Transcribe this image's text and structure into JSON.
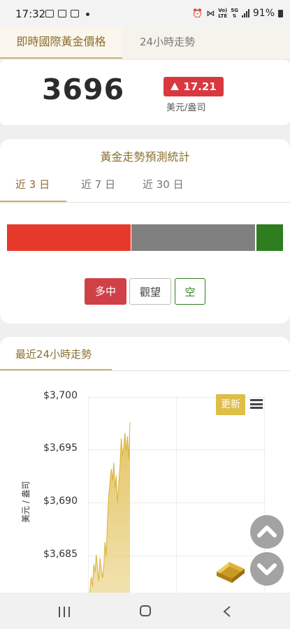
{
  "status_bar": {
    "time": "17:32",
    "network_lte": "LTE",
    "network_5g": "5G",
    "battery": "91%"
  },
  "top_tabs": [
    {
      "label": "即時國際黃金價格",
      "active": true
    },
    {
      "label": "24小時走勢",
      "active": false
    }
  ],
  "price": {
    "value": "3696",
    "change": "17.21",
    "direction": "up",
    "unit": "美元/盎司"
  },
  "prediction": {
    "title": "黃金走勢預測統計",
    "tabs": [
      {
        "label": "近 3 日",
        "active": true
      },
      {
        "label": "近 7 日",
        "active": false
      },
      {
        "label": "近 30 日",
        "active": false
      }
    ],
    "distribution": {
      "bull": 0.45,
      "neutral": 0.45,
      "bear": 0.1
    },
    "buttons": {
      "bull": "多中",
      "watch": "觀望",
      "bear": "空"
    }
  },
  "trend": {
    "title": "最近24小時走勢",
    "refresh_label": "更新",
    "y_axis_label": "美元 / 盎司"
  },
  "colors": {
    "accent": "#8a6f2f",
    "bull": "#e5392b",
    "neutral": "#808080",
    "bear": "#2e7d1f",
    "area": "#e2c25a"
  },
  "chart_data": {
    "type": "area",
    "ylabel": "美元 / 盎司",
    "yticks": [
      "$3,700",
      "$3,695",
      "$3,690",
      "$3,685"
    ],
    "ylim": [
      3680,
      3700
    ],
    "grid": true,
    "series": [
      {
        "values": [
          3680.2,
          3681.8,
          3683.0,
          3682.1,
          3684.2,
          3683.4,
          3685.1,
          3683.9,
          3682.6,
          3684.8,
          3683.7,
          3682.9,
          3684.0,
          3686.3,
          3685.0,
          3688.4,
          3690.7,
          3691.9,
          3693.2,
          3692.1,
          3693.8,
          3691.3,
          3692.6,
          3690.0,
          3691.8,
          3693.5,
          3696.1,
          3694.4,
          3695.3,
          3696.6,
          3694.9,
          3696.3,
          3694.1,
          3697.6
        ]
      }
    ]
  }
}
